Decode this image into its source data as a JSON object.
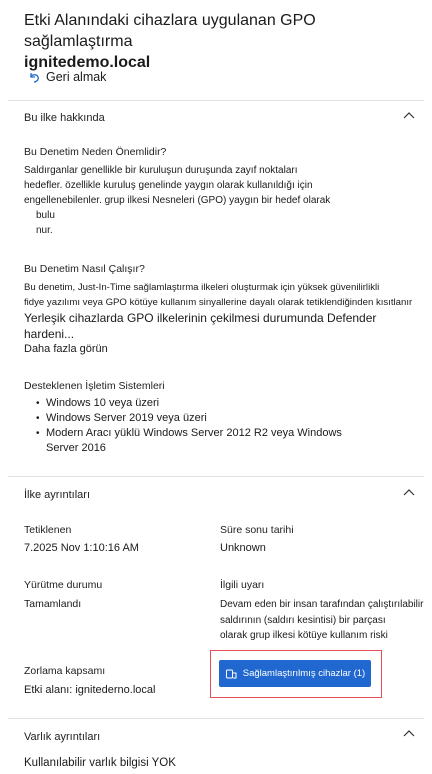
{
  "header": {
    "title_line1": "Etki Alanındaki cihazlara uygulanan GPO sağlamlaştırma",
    "title_line2": "ignitedemo.local",
    "back_label": "Geri almak"
  },
  "about": {
    "heading": "Bu ilke hakkında",
    "why_heading": "Bu Denetim Neden Önemlidir?",
    "why_lines": [
      "Saldırganlar genellikle bir kuruluşun duruşunda zayıf noktaları",
      "hedefler. özellikle kuruluş genelinde yaygın olarak kullanıldığı için",
      "engellenebilenler. grup ilkesi Nesneleri (GPO) yaygın bir hedef olarak",
      "bulu",
      "nur."
    ],
    "how_heading": "Bu Denetim Nasıl Çalışır?",
    "how_lines": [
      "Bu denetim, Just-In-Time sağlamlaştırma ilkeleri oluşturmak için yüksek güvenilirlikli",
      "fidye yazılımı veya GPO kötüye kullanım sinyallerine dayalı olarak tetiklendiğinden kısıtlanır"
    ],
    "how_big_lines": [
      "Yerleşik cihazlarda GPO ilkelerinin çekilmesi durumunda Defender",
      "hardeni..."
    ],
    "see_more": "Daha fazla görün",
    "os_heading": "Desteklenen İşletim Sistemleri",
    "os_items": [
      "Windows 10 veya üzeri",
      "Windows Server 2019 veya üzeri",
      "Modern Aracı yüklü Windows Server 2012 R2 veya Windows",
      "Server 2016"
    ]
  },
  "details": {
    "heading": "İlke ayrıntıları",
    "triggered_label": "Tetiklenen",
    "triggered_value": "7.2025 Nov 1:10:16 AM",
    "expires_label": "Süre sonu tarihi",
    "expires_value": "Unknown",
    "exec_label": "Yürütme durumu",
    "exec_value": "Tamamlandı",
    "alert_label": "İlgili uyarı",
    "alert_lines": [
      "Devam eden bir insan tarafından çalıştırılabilir",
      "saldırının (saldırı kesintisi) bir parçası",
      "olarak grup ilkesi kötüye kullanım riski"
    ],
    "scope_label": "Zorlama kapsamı",
    "scope_value": "Etki alanı: ignitederno.local",
    "button_label": "Sağlamlaştırılmış cihazlar (1)"
  },
  "asset": {
    "heading": "Varlık ayrıntıları",
    "value": "Kullanılabilir varlık bilgisi YOK"
  }
}
